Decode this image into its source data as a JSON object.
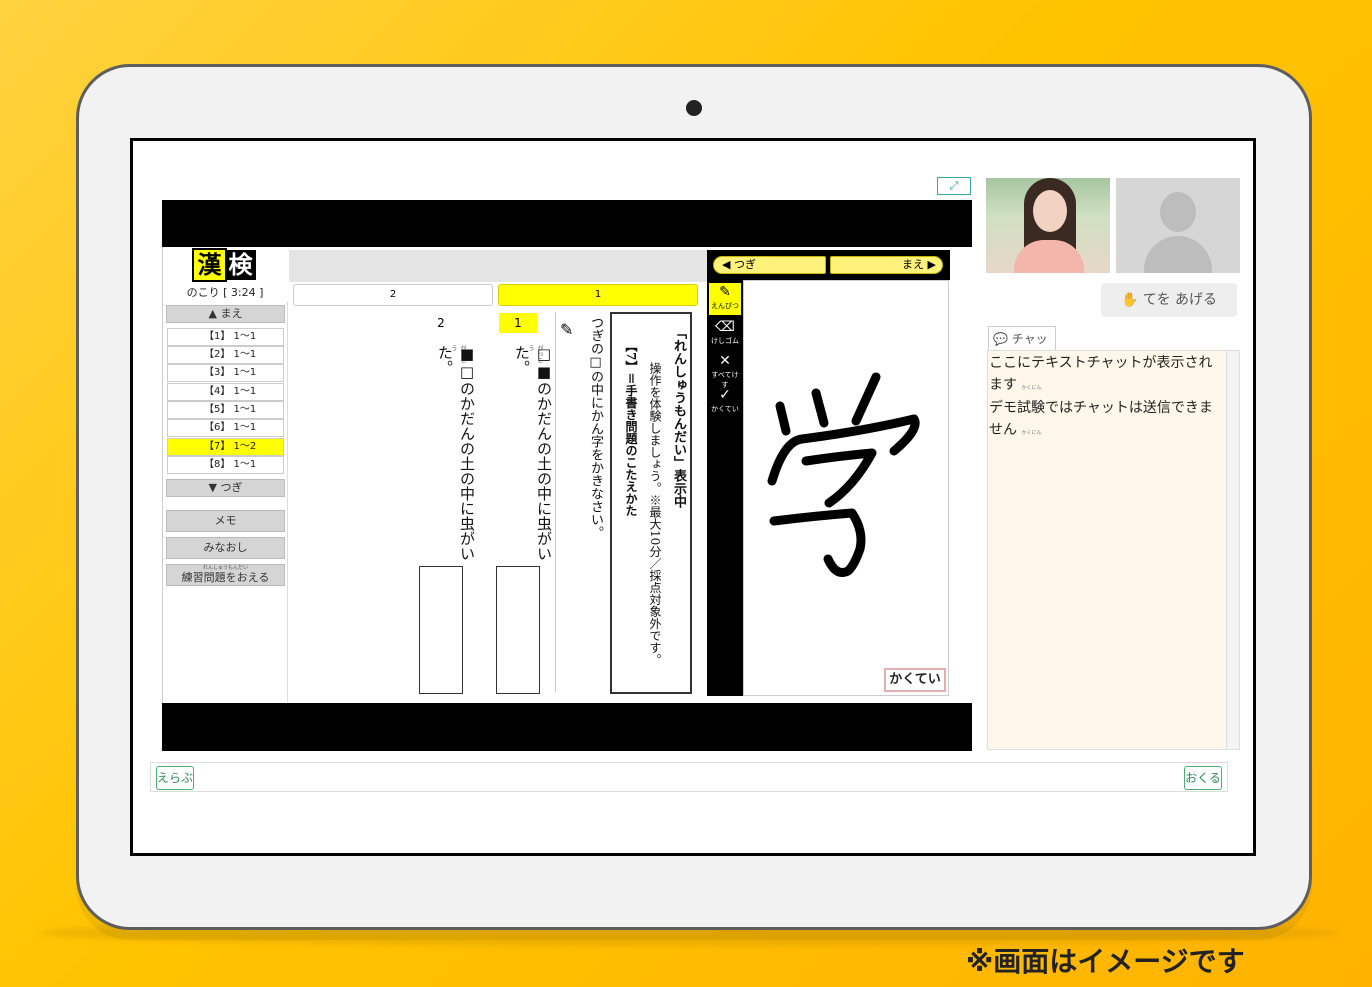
{
  "expand_icon": "⤢",
  "logo": {
    "char1": "漢",
    "char2": "検"
  },
  "timer": "のこり [ 3:24 ]",
  "sidebar": {
    "prev_label": "▲ まえ",
    "next_label": "▼ つぎ",
    "items": [
      {
        "label": "【1】 1～1",
        "active": false
      },
      {
        "label": "【2】 1～1",
        "active": false
      },
      {
        "label": "【3】 1～1",
        "active": false
      },
      {
        "label": "【4】 1～1",
        "active": false
      },
      {
        "label": "【5】 1～1",
        "active": false
      },
      {
        "label": "【6】 1～1",
        "active": false
      },
      {
        "label": "【7】 1～2",
        "active": true
      },
      {
        "label": "【8】 1～1",
        "active": false
      }
    ],
    "memo_label": "メモ",
    "review_label": "みなおし",
    "finish_ruby": "れんしゅうもんだい",
    "finish_label": "練習問題をおえる"
  },
  "tabs": [
    {
      "label": "2"
    },
    {
      "label": "1"
    }
  ],
  "instruction_box": {
    "line1": "「れんしゅうもんだい」表示中",
    "line2": "操作を体験しましょう。※最大10分／採点対象外です。",
    "line3": "【7】＝手書き問題のこたえかた"
  },
  "prompt": "つぎの□の中にかん字をかきなさい。",
  "questions": [
    {
      "number": "1",
      "text": "□■のかだんの土の中に虫がいた。",
      "ruby": "がっこう"
    },
    {
      "number": "2",
      "text": "■□のかだんの土の中に虫がいた。",
      "ruby": "がっこう"
    }
  ],
  "tools": [
    {
      "icon": "pencil-icon",
      "glyph": "✎",
      "label": "えんぴつ"
    },
    {
      "icon": "eraser-icon",
      "glyph": "⌫",
      "label": "けしゴム"
    },
    {
      "icon": "clear-all-icon",
      "glyph": "✕",
      "label": "すべてけす"
    },
    {
      "icon": "check-icon",
      "glyph": "✓",
      "label": "かくてい"
    }
  ],
  "drawing_nav": {
    "next_label": "つぎ",
    "prev_label": "まえ"
  },
  "kakutei_label": "かくてい",
  "raise_hand": {
    "icon": "hand-icon",
    "label": "てを あげる"
  },
  "chat": {
    "label": "チャット",
    "messages": [
      {
        "text": "ここにテキストチャットが表示されます",
        "ruby": "かくにん"
      },
      {
        "text": "デモ試験ではチャットは送信できません",
        "ruby": "かくにん"
      }
    ]
  },
  "input_bar": {
    "left_button": "えらぶ",
    "right_button": "おくる"
  },
  "caption": "※画面はイメージです",
  "colors": {
    "accent_yellow": "#ffff00",
    "background_yellow": "#ffc400",
    "chat_bg": "#fff8ea"
  }
}
